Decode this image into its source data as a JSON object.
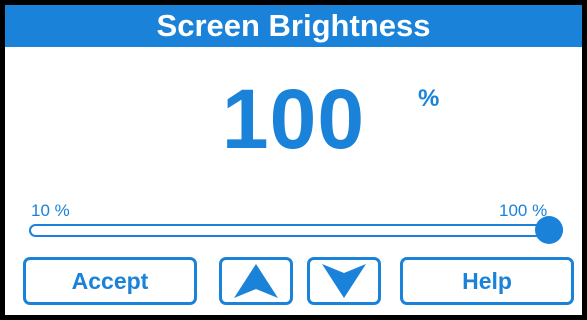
{
  "header": {
    "title": "Screen Brightness"
  },
  "brightness": {
    "value": "100",
    "unit": "%",
    "min_label": "10 %",
    "max_label": "100 %",
    "level_fraction": 1.0
  },
  "buttons": {
    "accept_label": "Accept",
    "up_icon": "arrow-up-icon",
    "down_icon": "arrow-down-icon",
    "help_label": "Help"
  },
  "colors": {
    "accent": "#1a82d8",
    "background": "#ffffff",
    "border": "#000000"
  }
}
